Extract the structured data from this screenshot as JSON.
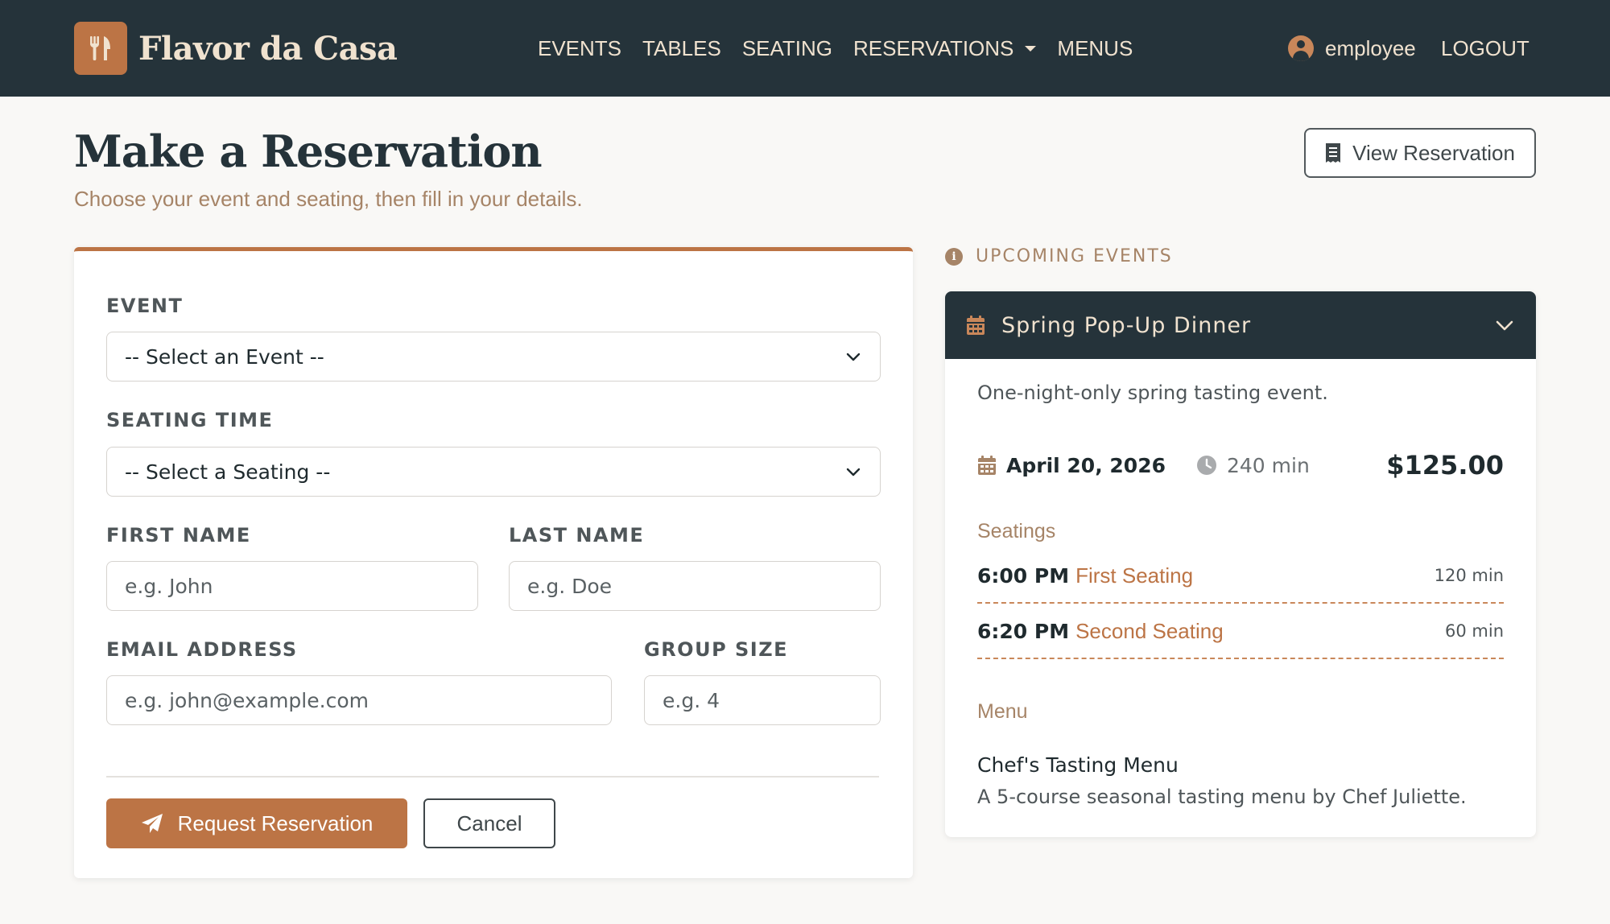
{
  "brand": {
    "name": "Flavor da Casa",
    "logo_icon": "utensils-icon"
  },
  "nav": {
    "links": [
      "EVENTS",
      "TABLES",
      "SEATING",
      "RESERVATIONS",
      "MENUS"
    ],
    "user": "employee",
    "logout": "LOGOUT"
  },
  "header": {
    "title": "Make a Reservation",
    "subtitle": "Choose your event and seating, then fill in your details.",
    "view_button": "View Reservation"
  },
  "form": {
    "event_label": "EVENT",
    "event_selected": "-- Select an Event --",
    "seating_label": "SEATING TIME",
    "seating_selected": "-- Select a Seating --",
    "first_name_label": "FIRST NAME",
    "first_name_placeholder": "e.g. John",
    "last_name_label": "LAST NAME",
    "last_name_placeholder": "e.g. Doe",
    "email_label": "EMAIL ADDRESS",
    "email_placeholder": "e.g. john@example.com",
    "group_label": "GROUP SIZE",
    "group_placeholder": "e.g. 4",
    "submit": "Request Reservation",
    "cancel": "Cancel"
  },
  "sidebar": {
    "heading": "UPCOMING EVENTS",
    "event": {
      "title": "Spring Pop-Up Dinner",
      "description": "One-night-only spring tasting event.",
      "date": "April 20, 2026",
      "duration": "240 min",
      "price": "$125.00",
      "seatings_label": "Seatings",
      "seatings": [
        {
          "time": "6:00 PM",
          "name": "First Seating",
          "duration": "120 min"
        },
        {
          "time": "6:20 PM",
          "name": "Second Seating",
          "duration": "60 min"
        }
      ],
      "menu_label": "Menu",
      "menu_name": "Chef's Tasting Menu",
      "menu_description": "A 5-course seasonal tasting menu by Chef Juliette."
    }
  },
  "colors": {
    "navbar": "#25333a",
    "accent": "#bc7445",
    "muted": "#a68467",
    "cream": "#f0e2cf"
  }
}
